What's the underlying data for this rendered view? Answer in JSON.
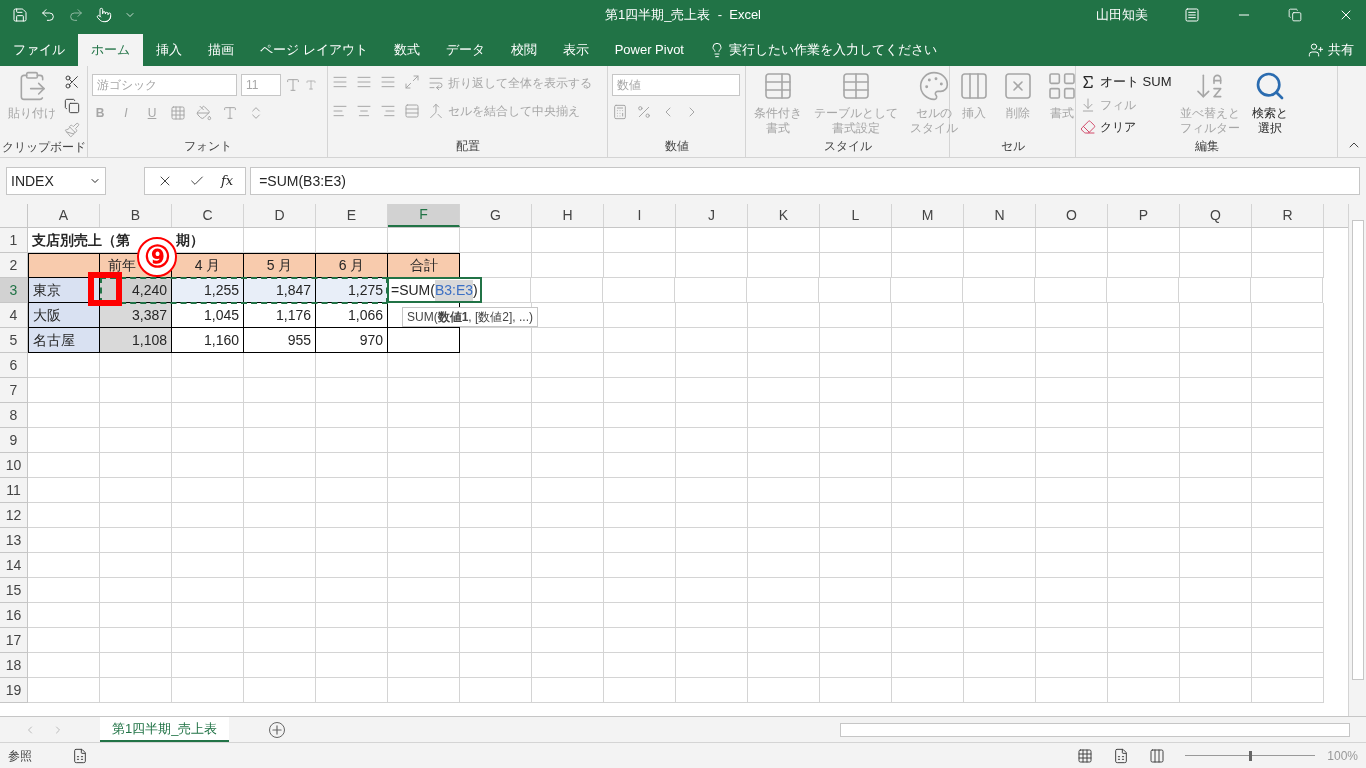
{
  "window": {
    "title": "第1四半期_売上表  -  Excel",
    "user": "山田知美"
  },
  "menu_tabs": [
    {
      "label": "ファイル",
      "selected": false
    },
    {
      "label": "ホーム",
      "selected": true
    },
    {
      "label": "挿入",
      "selected": false
    },
    {
      "label": "描画",
      "selected": false
    },
    {
      "label": "ページ レイアウト",
      "selected": false
    },
    {
      "label": "数式",
      "selected": false
    },
    {
      "label": "データ",
      "selected": false
    },
    {
      "label": "校閲",
      "selected": false
    },
    {
      "label": "表示",
      "selected": false
    },
    {
      "label": "Power Pivot",
      "selected": false
    }
  ],
  "tell_me": {
    "placeholder": "実行したい作業を入力してください"
  },
  "share": "共有",
  "ribbon": {
    "clipboard": {
      "label": "クリップボード",
      "paste": {
        "label": "貼り付け",
        "disabled": true
      }
    },
    "font": {
      "label": "フォント",
      "font_name": "游ゴシック",
      "font_size": "11",
      "bold": "B",
      "italic": "I",
      "underline": "U",
      "disabled": true
    },
    "alignment": {
      "label": "配置",
      "wrap": {
        "label": "折り返して全体を表示する",
        "disabled": true
      },
      "merge": {
        "label": "セルを結合して中央揃え",
        "disabled": true
      }
    },
    "number": {
      "label": "数値",
      "format": "数値",
      "disabled": true
    },
    "styles": {
      "label": "スタイル",
      "buttons": [
        {
          "lines": [
            "条件付き",
            "書式"
          ],
          "disabled": true
        },
        {
          "lines": [
            "テーブルとして",
            "書式設定"
          ],
          "disabled": true
        },
        {
          "lines": [
            "セルの",
            "スタイル"
          ],
          "disabled": true
        }
      ]
    },
    "cells": {
      "label": "セル",
      "buttons": [
        {
          "label": "挿入",
          "disabled": true
        },
        {
          "label": "削除",
          "disabled": true
        },
        {
          "label": "書式",
          "disabled": true
        }
      ]
    },
    "editing": {
      "label": "編集",
      "autosum": {
        "label": "オート SUM",
        "disabled": false
      },
      "fill": {
        "label": "フィル",
        "disabled": true
      },
      "clear": {
        "label": "クリア",
        "disabled": false
      },
      "sort": {
        "lines": [
          "並べ替えと",
          "フィルター"
        ],
        "disabled": true
      },
      "find": {
        "lines": [
          "検索と",
          "選択"
        ],
        "disabled": false
      }
    }
  },
  "formula_bar": {
    "name_box": "INDEX",
    "fx": "fx",
    "formula": "=SUM(B3:E3)"
  },
  "columns": [
    {
      "label": "A",
      "selected": false
    },
    {
      "label": "B",
      "selected": false
    },
    {
      "label": "C",
      "selected": false
    },
    {
      "label": "D",
      "selected": false
    },
    {
      "label": "E",
      "selected": false
    },
    {
      "label": "F",
      "selected": true
    },
    {
      "label": "G",
      "selected": false
    },
    {
      "label": "H",
      "selected": false
    },
    {
      "label": "I",
      "selected": false
    },
    {
      "label": "J",
      "selected": false
    },
    {
      "label": "K",
      "selected": false
    },
    {
      "label": "L",
      "selected": false
    },
    {
      "label": "M",
      "selected": false
    },
    {
      "label": "N",
      "selected": false
    },
    {
      "label": "O",
      "selected": false
    },
    {
      "label": "P",
      "selected": false
    },
    {
      "label": "Q",
      "selected": false
    },
    {
      "label": "R",
      "selected": false
    }
  ],
  "rows": [
    {
      "label": "1",
      "selected": false,
      "cells": [
        {
          "kind": "title",
          "text": "支店別売上（第",
          "tail": "期）"
        }
      ]
    },
    {
      "label": "2",
      "selected": false,
      "cells": [
        {
          "kind": "header",
          "color": "#f8cbad"
        },
        {
          "kind": "header",
          "text": "前年",
          "color": "#f8cbad"
        },
        {
          "kind": "header",
          "text": "4 月",
          "color": "#f8cbad"
        },
        {
          "kind": "header",
          "text": "5 月",
          "color": "#f8cbad"
        },
        {
          "kind": "header",
          "text": "6 月",
          "color": "#f8cbad"
        },
        {
          "kind": "header",
          "text": "合計",
          "color": "#f8cbad"
        }
      ]
    },
    {
      "label": "3",
      "selected": true,
      "cells": [
        {
          "kind": "text",
          "text": "東京",
          "color": "#d9e1f2"
        },
        {
          "kind": "number",
          "text": "4,240",
          "color": "#d0d0d0"
        },
        {
          "kind": "number",
          "text": "1,255",
          "color": "#e8eef8"
        },
        {
          "kind": "number",
          "text": "1,847",
          "color": "#e8eef8"
        },
        {
          "kind": "number",
          "text": "1,275",
          "color": "#e8eef8"
        },
        {
          "kind": "formula",
          "parts": [
            {
              "kind": "plain",
              "text": "=SUM("
            },
            {
              "kind": "ref",
              "text": "B3:E3"
            },
            {
              "kind": "plain",
              "text": ")"
            }
          ]
        }
      ]
    },
    {
      "label": "4",
      "selected": false,
      "cells": [
        {
          "kind": "text",
          "text": "大阪",
          "color": "#d9e1f2"
        },
        {
          "kind": "number",
          "text": "3,387",
          "color": "#d9d9d9"
        },
        {
          "kind": "number",
          "text": "1,045"
        },
        {
          "kind": "number",
          "text": "1,176"
        },
        {
          "kind": "number",
          "text": "1,066"
        },
        {
          "kind": "text"
        }
      ]
    },
    {
      "label": "5",
      "selected": false,
      "cells": [
        {
          "kind": "text",
          "text": "名古屋",
          "color": "#d9e1f2"
        },
        {
          "kind": "number",
          "text": "1,108",
          "color": "#d9d9d9"
        },
        {
          "kind": "number",
          "text": "1,160"
        },
        {
          "kind": "number",
          "text": "955"
        },
        {
          "kind": "number",
          "text": "970"
        },
        {
          "kind": "text"
        }
      ]
    },
    {
      "label": "6",
      "selected": false
    },
    {
      "label": "7",
      "selected": false
    },
    {
      "label": "8",
      "selected": false
    },
    {
      "label": "9",
      "selected": false
    },
    {
      "label": "10",
      "selected": false
    },
    {
      "label": "11",
      "selected": false
    },
    {
      "label": "12",
      "selected": false
    },
    {
      "label": "13",
      "selected": false
    },
    {
      "label": "14",
      "selected": false
    },
    {
      "label": "15",
      "selected": false
    },
    {
      "label": "16",
      "selected": false
    },
    {
      "label": "17",
      "selected": false
    },
    {
      "label": "18",
      "selected": false
    },
    {
      "label": "19",
      "selected": false
    }
  ],
  "function_tooltip": "SUM(**数値1**, [数値2], ...)",
  "step_badge": "⑨",
  "sheet_tabs": [
    {
      "label": "第1四半期_売上表",
      "selected": true
    }
  ],
  "status_bar": {
    "mode": "参照",
    "zoom": "100%"
  }
}
